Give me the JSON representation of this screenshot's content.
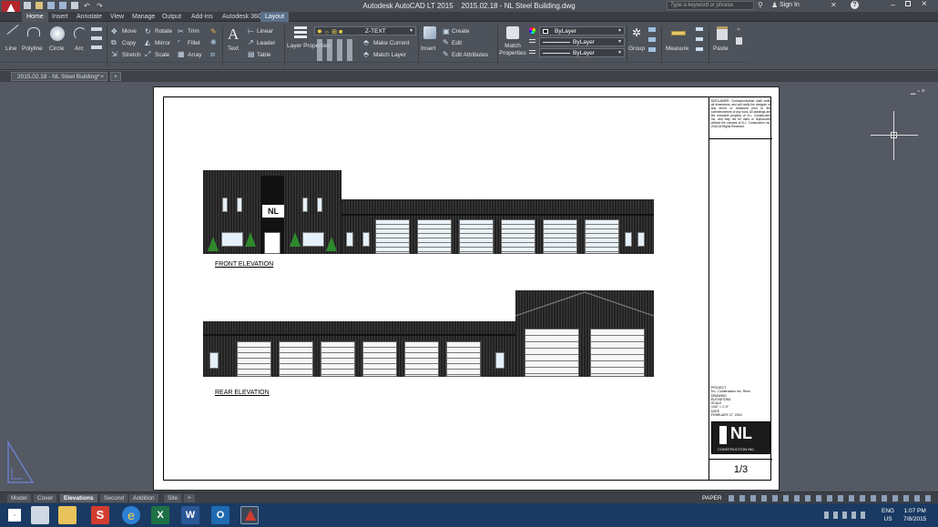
{
  "app": {
    "title": "Autodesk AutoCAD LT 2015",
    "file": "2015.02.18 - NL Steel Building.dwg",
    "search_placeholder": "Type a keyword or phrase",
    "sign_in": "Sign In"
  },
  "ribbon_tabs": [
    "Home",
    "Insert",
    "Annotate",
    "View",
    "Manage",
    "Output",
    "Add-ins",
    "Autodesk 360",
    "Layout"
  ],
  "ribbon": {
    "draw": {
      "line": "Line",
      "polyline": "Polyline",
      "circle": "Circle",
      "arc": "Arc"
    },
    "modify": {
      "move": "Move",
      "rotate": "Rotate",
      "trim": "Trim",
      "copy": "Copy",
      "mirror": "Mirror",
      "fillet": "Fillet",
      "stretch": "Stretch",
      "scale": "Scale",
      "array": "Array"
    },
    "annotation": {
      "text": "Text",
      "linear": "Linear",
      "leader": "Leader",
      "table": "Table"
    },
    "layers": {
      "layer_properties": "Layer Properties",
      "layer_name": "Z-TEXT",
      "make_current": "Make Current",
      "match_layer": "Match Layer"
    },
    "block": {
      "insert": "Insert",
      "create": "Create",
      "edit": "Edit",
      "edit_attributes": "Edit Attributes"
    },
    "properties": {
      "match_properties": "Match Properties",
      "bylayer1": "ByLayer",
      "bylayer2": "ByLayer",
      "bylayer3": "ByLayer"
    },
    "groups": {
      "group": "Group"
    },
    "utilities": {
      "measure": "Measure"
    },
    "clipboard": {
      "paste": "Paste"
    }
  },
  "doc_tab": "2015.02.18 - NL Steel Building*",
  "drawing": {
    "front_label": "FRONT ELEVATION",
    "rear_label": "REAR ELEVATION",
    "logo_text": "NL",
    "disclaimer": "DISCLAIMER: Contractor/builder shall verify all dimensions, and will notify the designer of any errors or omissions prior to the commencement of any work. All drawings are the exclusive property of N.L. Construction Inc. and may not be used or reproduced without the consent of N.L. Construction Inc. 2015 All Rights Reserved.",
    "title_block": {
      "project_label": "PROJECT",
      "project": "N.L. Construction Inc. Reno",
      "drawing_label": "DRAWING",
      "drawing": "ELEVATIONS",
      "scale_label": "SCALE",
      "scale": "1/32\" = 1'-0\"",
      "date_label": "DATE",
      "date": "FEBRUARY 27, 2015",
      "company": "CONSTRUCTION INC.",
      "sheet": "1/3"
    }
  },
  "layout_tabs": [
    "Model",
    "Cover",
    "Elevations",
    "Second",
    "Addition",
    "Site"
  ],
  "active_layout": "Elevations",
  "status": {
    "paper": "PAPER"
  },
  "taskbar": {
    "lang": "ENG",
    "region": "US",
    "time": "1:07 PM",
    "date": "7/8/2015"
  }
}
